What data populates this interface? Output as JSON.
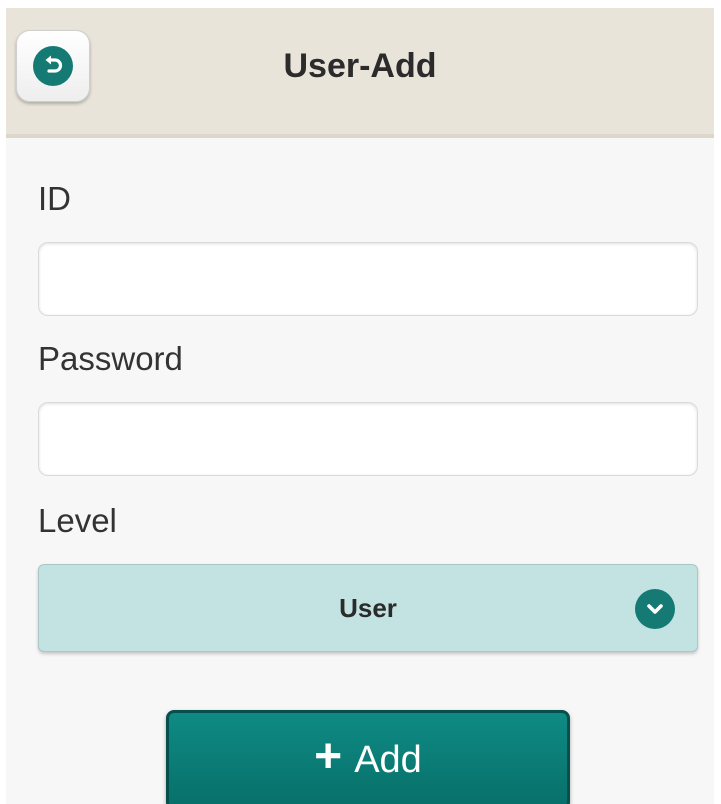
{
  "header": {
    "title": "User-Add",
    "back_icon": "undo-arrow-icon"
  },
  "form": {
    "id_label": "ID",
    "id_value": "",
    "password_label": "Password",
    "password_value": "",
    "level_label": "Level",
    "level_value": "User",
    "level_icon": "chevron-down-circle-icon"
  },
  "actions": {
    "add_label": "Add",
    "add_icon": "plus-icon"
  },
  "colors": {
    "header_bg": "#e9e4da",
    "accent": "#147a73",
    "select_bg": "#c3e3e2",
    "button_bg": "#0b7e78"
  }
}
